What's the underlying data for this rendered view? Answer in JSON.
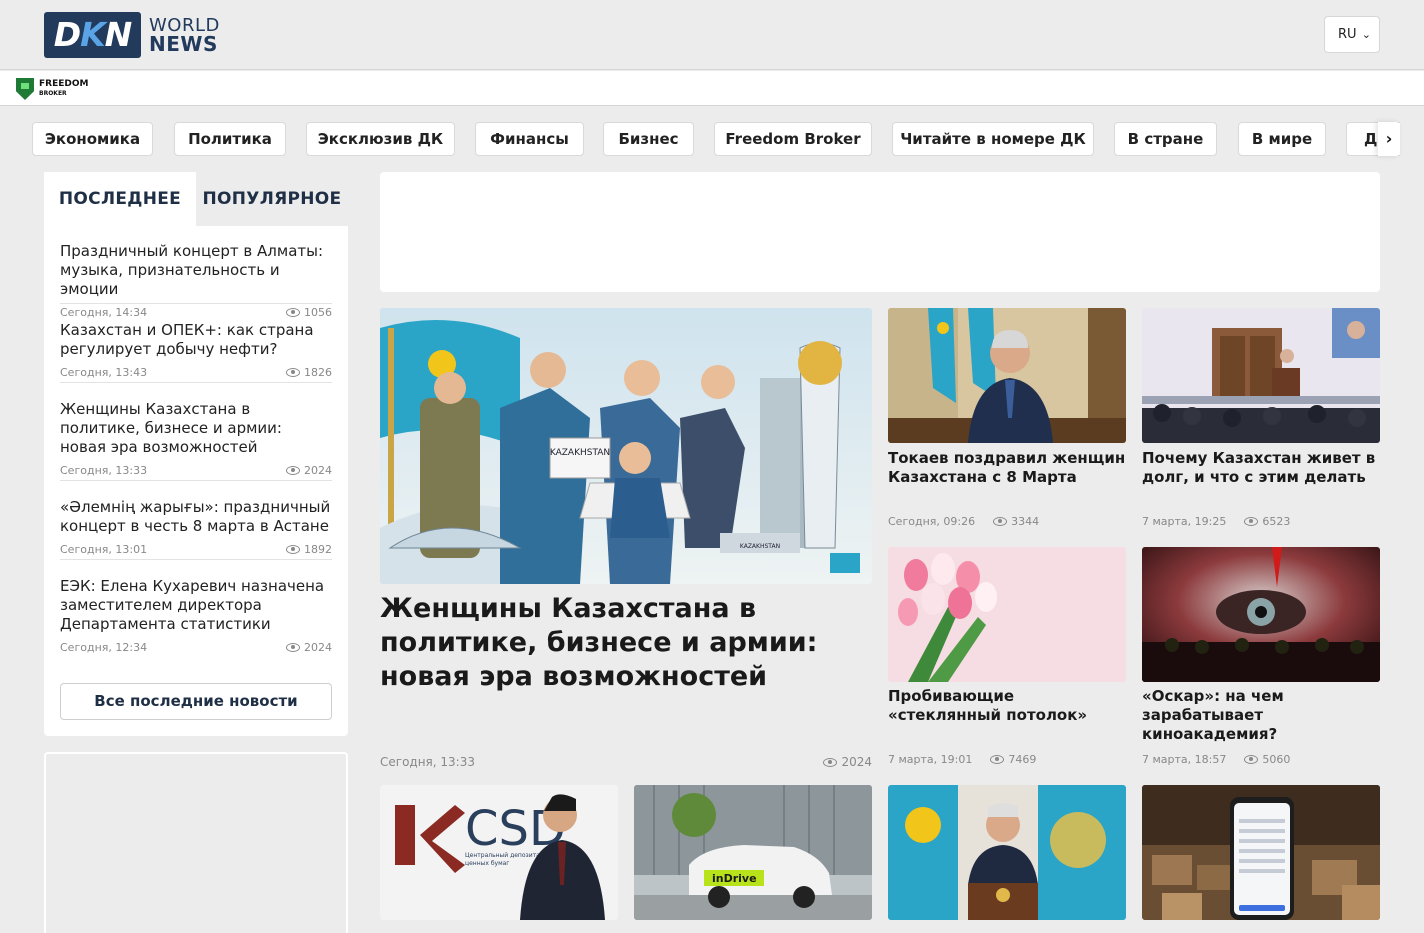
{
  "header": {
    "logo_abbr_d": "D",
    "logo_abbr_k": "K",
    "logo_abbr_n": "N",
    "logo_line1": "WORLD",
    "logo_line2": "NEWS",
    "language": "RU"
  },
  "sponsor": {
    "name_line1": "FREEDOM",
    "name_line2": "BROKER"
  },
  "categories": [
    "Экономика",
    "Политика",
    "Эксклюзив ДК",
    "Финансы",
    "Бизнес",
    "Freedom Broker",
    "Читайте в номере ДК",
    "В стране",
    "В мире",
    "ДК"
  ],
  "sidebar": {
    "tab_latest": "ПОСЛЕДНЕЕ",
    "tab_popular": "ПОПУЛЯРНОЕ",
    "items": [
      {
        "title": "Праздничный концерт в Алматы: музыка, признательность и эмоции",
        "time": "Сегодня, 14:34",
        "views": "1056"
      },
      {
        "title": "Казахстан и ОПЕК+: как страна регулирует добычу нефти?",
        "time": "Сегодня, 13:43",
        "views": "1826"
      },
      {
        "title": "Женщины Казахстана в политике, бизнесе и армии: новая эра возможностей",
        "time": "Сегодня, 13:33",
        "views": "2024"
      },
      {
        "title": "«Әлемнің жарығы»: праздничный концерт в честь 8 марта в Астане",
        "time": "Сегодня, 13:01",
        "views": "1892"
      },
      {
        "title": "ЕЭК: Елена Кухаревич назначена заместителем директора Департамента статистики",
        "time": "Сегодня, 12:34",
        "views": "2024"
      }
    ],
    "all_news": "Все последние новости"
  },
  "featured": {
    "title": "Женщины Казахстана в политике, бизнесе и армии: новая эра возможностей",
    "time": "Сегодня, 13:33",
    "views": "2024",
    "sign_text": "KAZAKHSTAN",
    "building_text": "KAZAKHSTAN"
  },
  "cards": [
    {
      "title": "Токаев поздравил женщин Казахстана с 8 Марта",
      "time": "Сегодня, 09:26",
      "views": "3344"
    },
    {
      "title": "Почему Казахстан живет в долг, и что с этим делать",
      "time": "7 марта, 19:25",
      "views": "6523"
    },
    {
      "title": "Пробивающие «стеклянный потолок»",
      "time": "7 марта, 19:01",
      "views": "7469"
    },
    {
      "title": "«Оскар»: на чем зарабатывает киноакадемия?",
      "time": "7 марта, 18:57",
      "views": "5060"
    }
  ],
  "bottom_cards": [
    {
      "logo_text": "CSD",
      "caption_line1": "Центральный депозитарий",
      "caption_line2": "ценных бумаг"
    },
    {
      "car_text": "inDrive"
    },
    {},
    {}
  ]
}
